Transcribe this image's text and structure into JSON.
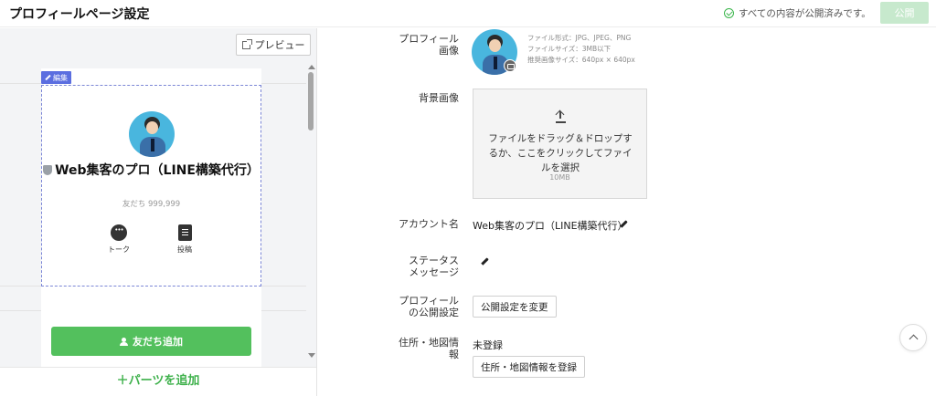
{
  "header": {
    "title": "プロフィールページ設定",
    "status_text": "すべての内容が公開済みです。",
    "publish_label": "公開"
  },
  "preview_panel": {
    "preview_button_label": "プレビュー",
    "edit_tag_label": "編集",
    "profile": {
      "name": "Web集客のプロ（LINE構築代行）",
      "friends_count": "友だち 999,999"
    },
    "actions": [
      {
        "label": "トーク",
        "icon": "talk-icon"
      },
      {
        "label": "投稿",
        "icon": "post-icon"
      }
    ],
    "add_friend_label": "友だち追加",
    "add_parts_label": "＋パーツを追加"
  },
  "form": {
    "profile_image": {
      "label_line1": "プロフィール",
      "label_line2": "画像",
      "hint_format": "ファイル形式：JPG、JPEG、PNG",
      "hint_size": "ファイルサイズ：3MB以下",
      "hint_recommended": "推奨画像サイズ：640px × 640px"
    },
    "background_image": {
      "label": "背景画像",
      "drop_text": "ファイルをドラッグ＆ドロップするか、ここをクリックしてファイルを選択",
      "max_size": "10MB"
    },
    "account_name": {
      "label": "アカウント名",
      "value": "Web集客のプロ（LINE構築代行）"
    },
    "status_message": {
      "label_line1": "ステータス",
      "label_line2": "メッセージ"
    },
    "profile_visibility": {
      "label_line1": "プロフィール",
      "label_line2": "の公開設定",
      "button_label": "公開設定を変更"
    },
    "address": {
      "label_line1": "住所・地図情",
      "label_line2": "報",
      "value": "未登録",
      "button_label": "住所・地図情報を登録"
    }
  },
  "colors": {
    "accent_green": "#53c05d",
    "publish_disabled": "#c7e9cd",
    "edit_blue": "#5b6ee0",
    "avatar_bg": "#49b6de"
  }
}
